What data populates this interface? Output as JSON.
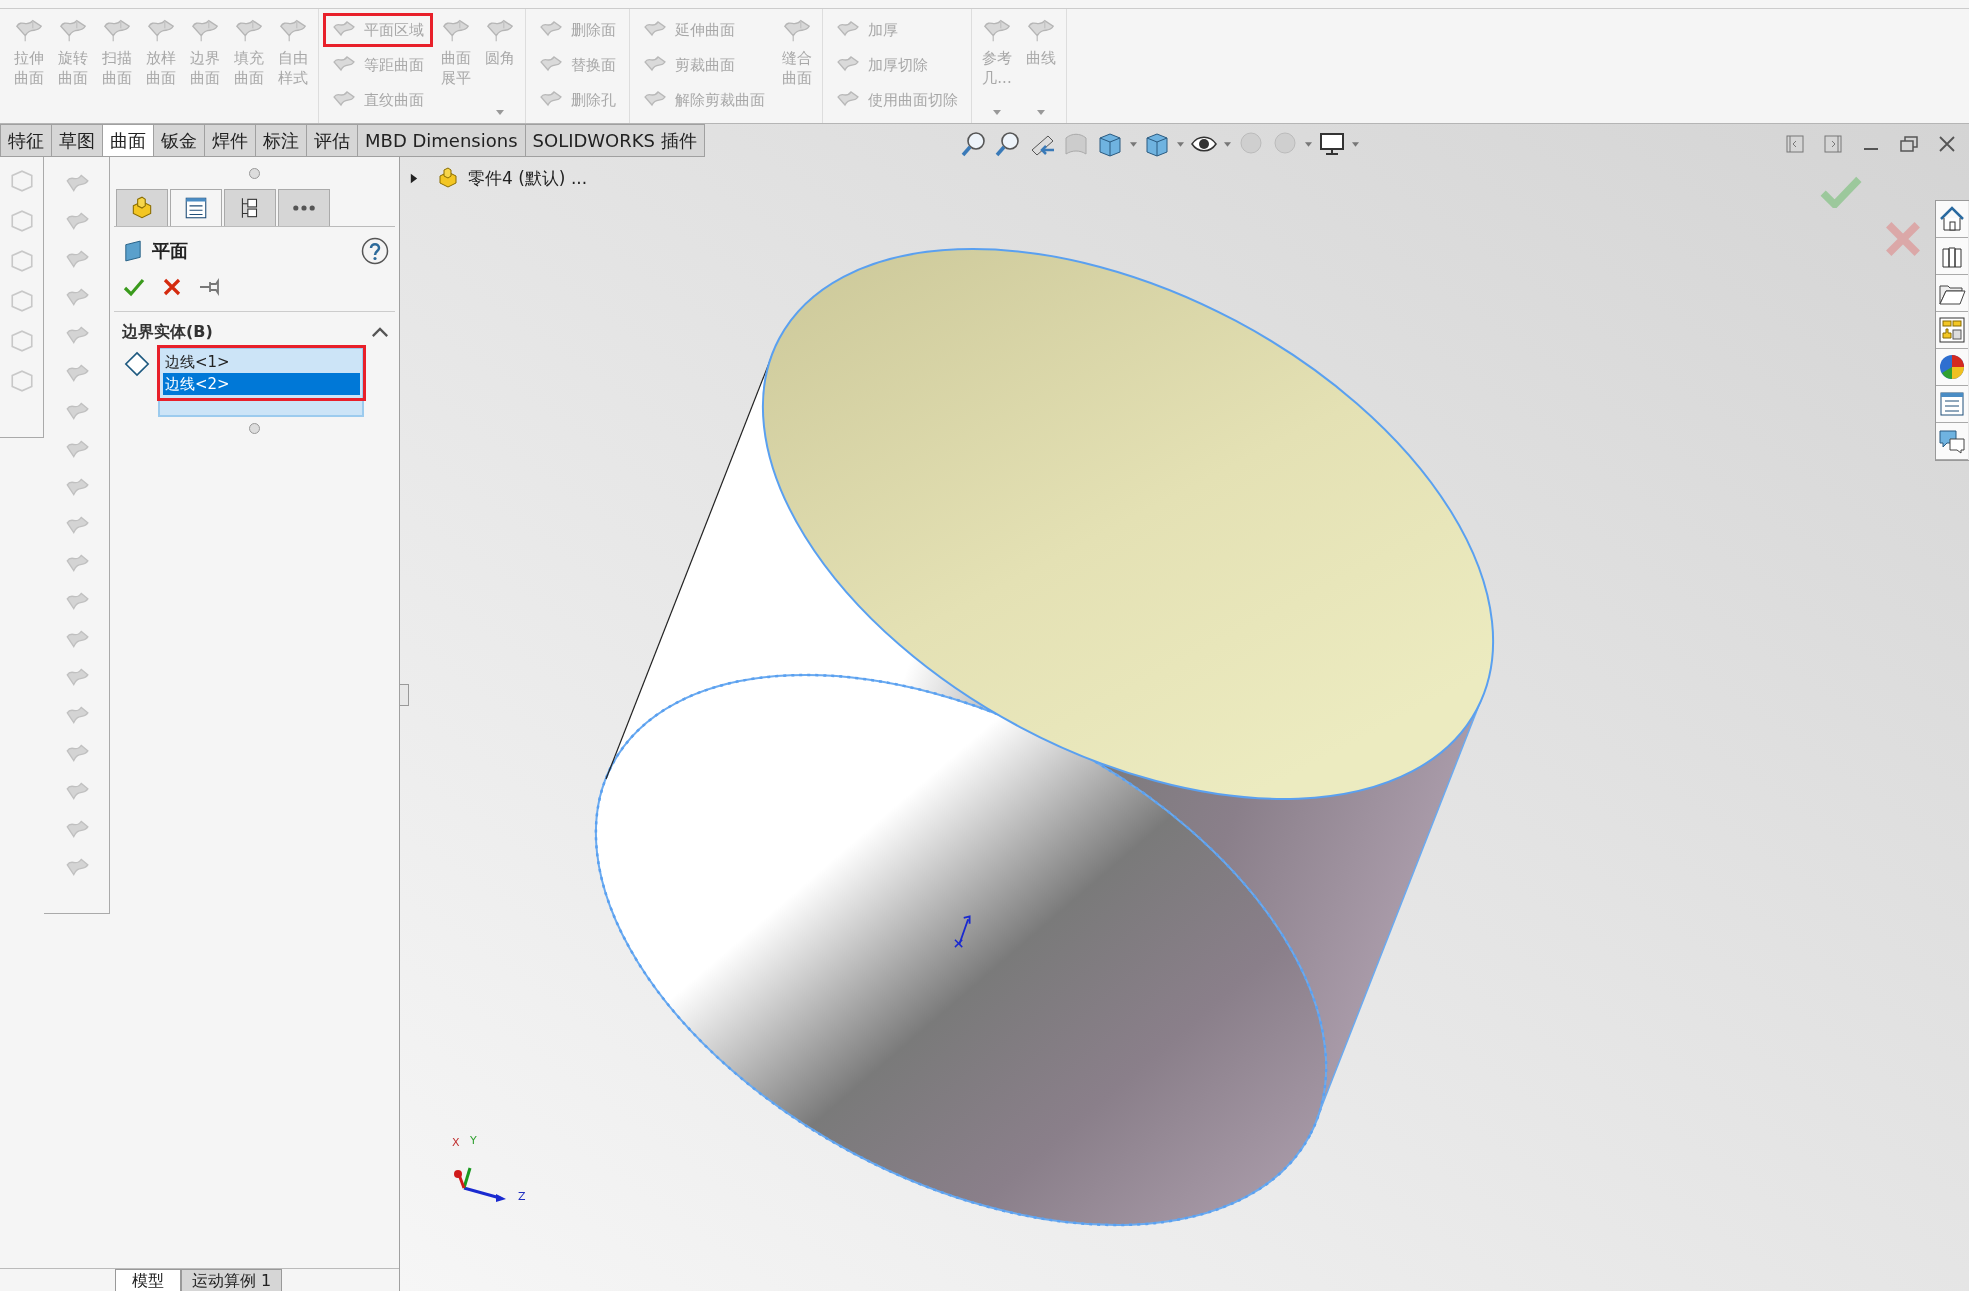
{
  "ribbon": {
    "groups": [
      {
        "blocks": [
          {
            "kind": "large",
            "label": "拉伸曲面",
            "disabled": true,
            "dropdown": false
          },
          {
            "kind": "large",
            "label": "旋转曲面",
            "disabled": true,
            "dropdown": false
          },
          {
            "kind": "large",
            "label": "扫描曲面",
            "disabled": true,
            "dropdown": false
          },
          {
            "kind": "large",
            "label": "放样曲面",
            "disabled": true,
            "dropdown": false
          },
          {
            "kind": "large",
            "label": "边界曲面",
            "disabled": true,
            "dropdown": false
          },
          {
            "kind": "large",
            "label": "填充曲面",
            "disabled": true,
            "dropdown": false
          },
          {
            "kind": "large",
            "label": "自由样式",
            "disabled": true,
            "dropdown": false
          }
        ]
      },
      {
        "blocks": [
          {
            "kind": "stack",
            "items": [
              {
                "label": "平面区域",
                "disabled": true,
                "highlighted": true
              },
              {
                "label": "等距曲面",
                "disabled": true,
                "highlighted": false
              },
              {
                "label": "直纹曲面",
                "disabled": true,
                "highlighted": false
              }
            ]
          },
          {
            "kind": "large",
            "label": "曲面展平",
            "disabled": true,
            "dropdown": false
          },
          {
            "kind": "large",
            "label": "圆角",
            "disabled": true,
            "dropdown": true
          }
        ]
      },
      {
        "blocks": [
          {
            "kind": "stack",
            "items": [
              {
                "label": "删除面",
                "disabled": true,
                "highlighted": false
              },
              {
                "label": "替换面",
                "disabled": true,
                "highlighted": false
              },
              {
                "label": "删除孔",
                "disabled": true,
                "highlighted": false
              }
            ]
          }
        ]
      },
      {
        "blocks": [
          {
            "kind": "stack",
            "items": [
              {
                "label": "延伸曲面",
                "disabled": true,
                "highlighted": false
              },
              {
                "label": "剪裁曲面",
                "disabled": true,
                "highlighted": false
              },
              {
                "label": "解除剪裁曲面",
                "disabled": true,
                "highlighted": false
              }
            ]
          },
          {
            "kind": "large",
            "label": "缝合曲面",
            "disabled": true,
            "dropdown": false
          }
        ]
      },
      {
        "blocks": [
          {
            "kind": "stack",
            "items": [
              {
                "label": "加厚",
                "disabled": true,
                "highlighted": false
              },
              {
                "label": "加厚切除",
                "disabled": true,
                "highlighted": false
              },
              {
                "label": "使用曲面切除",
                "disabled": true,
                "highlighted": false
              }
            ]
          }
        ]
      },
      {
        "blocks": [
          {
            "kind": "large",
            "label": "参考几...",
            "disabled": true,
            "dropdown": true
          },
          {
            "kind": "large",
            "label": "曲线",
            "disabled": true,
            "dropdown": true
          }
        ]
      }
    ]
  },
  "tabs": [
    {
      "label": "特征",
      "selected": false
    },
    {
      "label": "草图",
      "selected": false
    },
    {
      "label": "曲面",
      "selected": true
    },
    {
      "label": "钣金",
      "selected": false
    },
    {
      "label": "焊件",
      "selected": false
    },
    {
      "label": "标注",
      "selected": false
    },
    {
      "label": "评估",
      "selected": false
    },
    {
      "label": "MBD Dimensions",
      "selected": false
    },
    {
      "label": "SOLIDWORKS 插件",
      "selected": false
    }
  ],
  "property_manager": {
    "tabs": [
      {
        "selected": false
      },
      {
        "selected": true
      },
      {
        "selected": false
      },
      {
        "selected": false
      }
    ],
    "title": "平面",
    "section": {
      "title": "边界实体(B)",
      "expanded": true,
      "list": {
        "highlighted": true,
        "items": [
          {
            "label": "边线<1>",
            "selected": false
          },
          {
            "label": "边线<2>",
            "selected": true
          }
        ]
      }
    }
  },
  "tree": {
    "label": "零件4 (默认) ...",
    "expanded": false
  },
  "triad": {
    "labels": [
      "X",
      "Y",
      "Z"
    ]
  },
  "bottom_tabs": [
    {
      "label": "模型",
      "selected": true
    },
    {
      "label": "运动算例 1",
      "selected": false
    }
  ]
}
